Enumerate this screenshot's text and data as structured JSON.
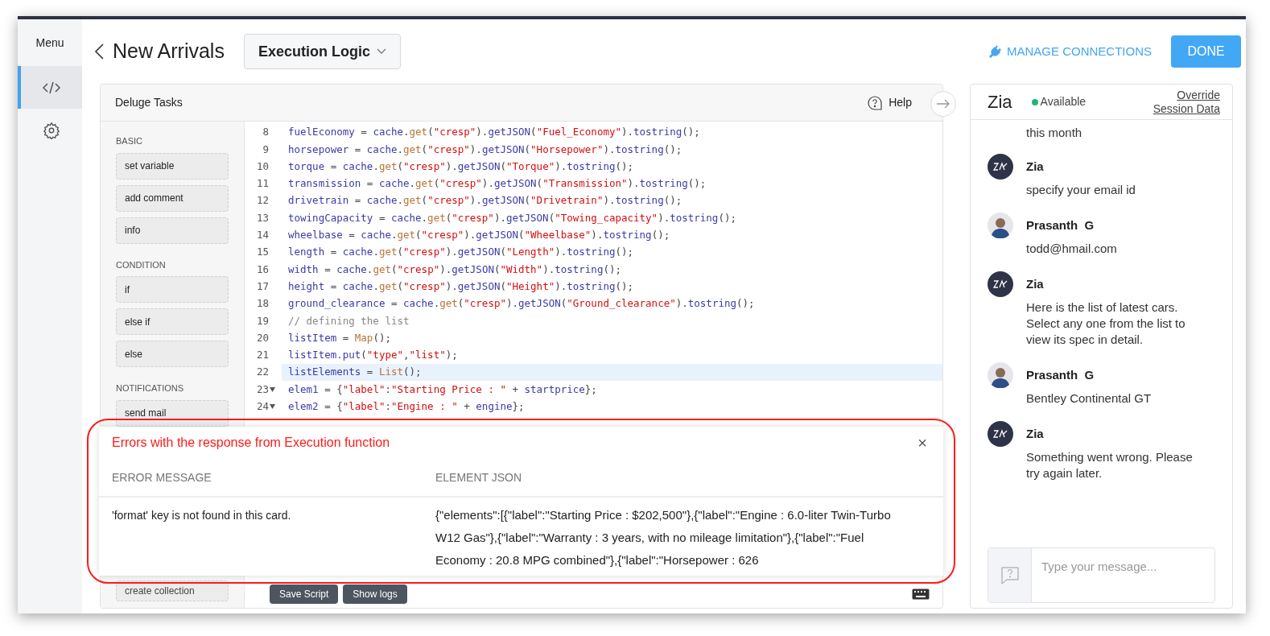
{
  "sidebar": {
    "title": "Menu",
    "items": [
      {
        "kind": "code",
        "selected": true
      },
      {
        "kind": "settings",
        "selected": false
      }
    ]
  },
  "header": {
    "title": "New Arrivals",
    "dropdown": "Execution Logic",
    "manage_connections": "MANAGE CONNECTIONS",
    "done": "DONE"
  },
  "editor": {
    "title": "Deluge Tasks",
    "help": "Help",
    "tasks": [
      {
        "title": "BASIC",
        "items": [
          "set variable",
          "add comment",
          "info"
        ]
      },
      {
        "title": "CONDITION",
        "items": [
          "if",
          "else if",
          "else"
        ]
      },
      {
        "title": "NOTIFICATIONS",
        "items": [
          "send mail"
        ]
      }
    ],
    "bottom_task": "create collection",
    "code_lines": [
      {
        "number": "8",
        "highlighted": false,
        "foldable": false,
        "tokens": [
          {
            "kind": "var",
            "text": "fuelEconomy"
          },
          {
            "kind": "op",
            "text": " = "
          },
          {
            "kind": "var",
            "text": "cache"
          },
          {
            "kind": "op",
            "text": "."
          },
          {
            "kind": "fn",
            "text": "get"
          },
          {
            "kind": "op",
            "text": "("
          },
          {
            "kind": "str",
            "text": "\"cresp\""
          },
          {
            "kind": "op",
            "text": ")."
          },
          {
            "kind": "var",
            "text": "getJSON"
          },
          {
            "kind": "op",
            "text": "("
          },
          {
            "kind": "str",
            "text": "\"Fuel_Economy\""
          },
          {
            "kind": "op",
            "text": ")."
          },
          {
            "kind": "var",
            "text": "tostring"
          },
          {
            "kind": "op",
            "text": "();"
          }
        ]
      },
      {
        "number": "9",
        "highlighted": false,
        "foldable": false,
        "tokens": [
          {
            "kind": "var",
            "text": "horsepower"
          },
          {
            "kind": "op",
            "text": " = "
          },
          {
            "kind": "var",
            "text": "cache"
          },
          {
            "kind": "op",
            "text": "."
          },
          {
            "kind": "fn",
            "text": "get"
          },
          {
            "kind": "op",
            "text": "("
          },
          {
            "kind": "str",
            "text": "\"cresp\""
          },
          {
            "kind": "op",
            "text": ")."
          },
          {
            "kind": "var",
            "text": "getJSON"
          },
          {
            "kind": "op",
            "text": "("
          },
          {
            "kind": "str",
            "text": "\"Horsepower\""
          },
          {
            "kind": "op",
            "text": ")."
          },
          {
            "kind": "var",
            "text": "tostring"
          },
          {
            "kind": "op",
            "text": "();"
          }
        ]
      },
      {
        "number": "10",
        "highlighted": false,
        "foldable": false,
        "tokens": [
          {
            "kind": "var",
            "text": "torque"
          },
          {
            "kind": "op",
            "text": " = "
          },
          {
            "kind": "var",
            "text": "cache"
          },
          {
            "kind": "op",
            "text": "."
          },
          {
            "kind": "fn",
            "text": "get"
          },
          {
            "kind": "op",
            "text": "("
          },
          {
            "kind": "str",
            "text": "\"cresp\""
          },
          {
            "kind": "op",
            "text": ")."
          },
          {
            "kind": "var",
            "text": "getJSON"
          },
          {
            "kind": "op",
            "text": "("
          },
          {
            "kind": "str",
            "text": "\"Torque\""
          },
          {
            "kind": "op",
            "text": ")."
          },
          {
            "kind": "var",
            "text": "tostring"
          },
          {
            "kind": "op",
            "text": "();"
          }
        ]
      },
      {
        "number": "11",
        "highlighted": false,
        "foldable": false,
        "tokens": [
          {
            "kind": "var",
            "text": "transmission"
          },
          {
            "kind": "op",
            "text": " = "
          },
          {
            "kind": "var",
            "text": "cache"
          },
          {
            "kind": "op",
            "text": "."
          },
          {
            "kind": "fn",
            "text": "get"
          },
          {
            "kind": "op",
            "text": "("
          },
          {
            "kind": "str",
            "text": "\"cresp\""
          },
          {
            "kind": "op",
            "text": ")."
          },
          {
            "kind": "var",
            "text": "getJSON"
          },
          {
            "kind": "op",
            "text": "("
          },
          {
            "kind": "str",
            "text": "\"Transmission\""
          },
          {
            "kind": "op",
            "text": ")."
          },
          {
            "kind": "var",
            "text": "tostring"
          },
          {
            "kind": "op",
            "text": "();"
          }
        ]
      },
      {
        "number": "12",
        "highlighted": false,
        "foldable": false,
        "tokens": [
          {
            "kind": "var",
            "text": "drivetrain"
          },
          {
            "kind": "op",
            "text": " = "
          },
          {
            "kind": "var",
            "text": "cache"
          },
          {
            "kind": "op",
            "text": "."
          },
          {
            "kind": "fn",
            "text": "get"
          },
          {
            "kind": "op",
            "text": "("
          },
          {
            "kind": "str",
            "text": "\"cresp\""
          },
          {
            "kind": "op",
            "text": ")."
          },
          {
            "kind": "var",
            "text": "getJSON"
          },
          {
            "kind": "op",
            "text": "("
          },
          {
            "kind": "str",
            "text": "\"Drivetrain\""
          },
          {
            "kind": "op",
            "text": ")."
          },
          {
            "kind": "var",
            "text": "tostring"
          },
          {
            "kind": "op",
            "text": "();"
          }
        ]
      },
      {
        "number": "13",
        "highlighted": false,
        "foldable": false,
        "tokens": [
          {
            "kind": "var",
            "text": "towingCapacity"
          },
          {
            "kind": "op",
            "text": " = "
          },
          {
            "kind": "var",
            "text": "cache"
          },
          {
            "kind": "op",
            "text": "."
          },
          {
            "kind": "fn",
            "text": "get"
          },
          {
            "kind": "op",
            "text": "("
          },
          {
            "kind": "str",
            "text": "\"cresp\""
          },
          {
            "kind": "op",
            "text": ")."
          },
          {
            "kind": "var",
            "text": "getJSON"
          },
          {
            "kind": "op",
            "text": "("
          },
          {
            "kind": "str",
            "text": "\"Towing_capacity\""
          },
          {
            "kind": "op",
            "text": ")."
          },
          {
            "kind": "var",
            "text": "tostring"
          },
          {
            "kind": "op",
            "text": "();"
          }
        ]
      },
      {
        "number": "14",
        "highlighted": false,
        "foldable": false,
        "tokens": [
          {
            "kind": "var",
            "text": "wheelbase"
          },
          {
            "kind": "op",
            "text": " = "
          },
          {
            "kind": "var",
            "text": "cache"
          },
          {
            "kind": "op",
            "text": "."
          },
          {
            "kind": "fn",
            "text": "get"
          },
          {
            "kind": "op",
            "text": "("
          },
          {
            "kind": "str",
            "text": "\"cresp\""
          },
          {
            "kind": "op",
            "text": ")."
          },
          {
            "kind": "var",
            "text": "getJSON"
          },
          {
            "kind": "op",
            "text": "("
          },
          {
            "kind": "str",
            "text": "\"Wheelbase\""
          },
          {
            "kind": "op",
            "text": ")."
          },
          {
            "kind": "var",
            "text": "tostring"
          },
          {
            "kind": "op",
            "text": "();"
          }
        ]
      },
      {
        "number": "15",
        "highlighted": false,
        "foldable": false,
        "tokens": [
          {
            "kind": "var",
            "text": "length"
          },
          {
            "kind": "op",
            "text": " = "
          },
          {
            "kind": "var",
            "text": "cache"
          },
          {
            "kind": "op",
            "text": "."
          },
          {
            "kind": "fn",
            "text": "get"
          },
          {
            "kind": "op",
            "text": "("
          },
          {
            "kind": "str",
            "text": "\"cresp\""
          },
          {
            "kind": "op",
            "text": ")."
          },
          {
            "kind": "var",
            "text": "getJSON"
          },
          {
            "kind": "op",
            "text": "("
          },
          {
            "kind": "str",
            "text": "\"Length\""
          },
          {
            "kind": "op",
            "text": ")."
          },
          {
            "kind": "var",
            "text": "tostring"
          },
          {
            "kind": "op",
            "text": "();"
          }
        ]
      },
      {
        "number": "16",
        "highlighted": false,
        "foldable": false,
        "tokens": [
          {
            "kind": "var",
            "text": "width"
          },
          {
            "kind": "op",
            "text": " = "
          },
          {
            "kind": "var",
            "text": "cache"
          },
          {
            "kind": "op",
            "text": "."
          },
          {
            "kind": "fn",
            "text": "get"
          },
          {
            "kind": "op",
            "text": "("
          },
          {
            "kind": "str",
            "text": "\"cresp\""
          },
          {
            "kind": "op",
            "text": ")."
          },
          {
            "kind": "var",
            "text": "getJSON"
          },
          {
            "kind": "op",
            "text": "("
          },
          {
            "kind": "str",
            "text": "\"Width\""
          },
          {
            "kind": "op",
            "text": ")."
          },
          {
            "kind": "var",
            "text": "tostring"
          },
          {
            "kind": "op",
            "text": "();"
          }
        ]
      },
      {
        "number": "17",
        "highlighted": false,
        "foldable": false,
        "tokens": [
          {
            "kind": "var",
            "text": "height"
          },
          {
            "kind": "op",
            "text": " = "
          },
          {
            "kind": "var",
            "text": "cache"
          },
          {
            "kind": "op",
            "text": "."
          },
          {
            "kind": "fn",
            "text": "get"
          },
          {
            "kind": "op",
            "text": "("
          },
          {
            "kind": "str",
            "text": "\"cresp\""
          },
          {
            "kind": "op",
            "text": ")."
          },
          {
            "kind": "var",
            "text": "getJSON"
          },
          {
            "kind": "op",
            "text": "("
          },
          {
            "kind": "str",
            "text": "\"Height\""
          },
          {
            "kind": "op",
            "text": ")."
          },
          {
            "kind": "var",
            "text": "tostring"
          },
          {
            "kind": "op",
            "text": "();"
          }
        ]
      },
      {
        "number": "18",
        "highlighted": false,
        "foldable": false,
        "tokens": [
          {
            "kind": "var",
            "text": "ground_clearance"
          },
          {
            "kind": "op",
            "text": " = "
          },
          {
            "kind": "var",
            "text": "cache"
          },
          {
            "kind": "op",
            "text": "."
          },
          {
            "kind": "fn",
            "text": "get"
          },
          {
            "kind": "op",
            "text": "("
          },
          {
            "kind": "str",
            "text": "\"cresp\""
          },
          {
            "kind": "op",
            "text": ")."
          },
          {
            "kind": "var",
            "text": "getJSON"
          },
          {
            "kind": "op",
            "text": "("
          },
          {
            "kind": "str",
            "text": "\"Ground_clearance\""
          },
          {
            "kind": "op",
            "text": ")."
          },
          {
            "kind": "var",
            "text": "tostring"
          },
          {
            "kind": "op",
            "text": "();"
          }
        ]
      },
      {
        "number": "19",
        "highlighted": false,
        "foldable": false,
        "tokens": [
          {
            "kind": "comment",
            "text": "// defining the list"
          }
        ]
      },
      {
        "number": "20",
        "highlighted": false,
        "foldable": false,
        "tokens": [
          {
            "kind": "var",
            "text": "listItem"
          },
          {
            "kind": "op",
            "text": " = "
          },
          {
            "kind": "fn",
            "text": "Map"
          },
          {
            "kind": "op",
            "text": "();"
          }
        ]
      },
      {
        "number": "21",
        "highlighted": false,
        "foldable": false,
        "tokens": [
          {
            "kind": "var",
            "text": "listItem.put"
          },
          {
            "kind": "op",
            "text": "("
          },
          {
            "kind": "str",
            "text": "\"type\""
          },
          {
            "kind": "op",
            "text": ","
          },
          {
            "kind": "str",
            "text": "\"list\""
          },
          {
            "kind": "op",
            "text": ");"
          }
        ]
      },
      {
        "number": "22",
        "highlighted": true,
        "foldable": false,
        "tokens": [
          {
            "kind": "var",
            "text": "listElements"
          },
          {
            "kind": "op",
            "text": " = "
          },
          {
            "kind": "fn",
            "text": "List"
          },
          {
            "kind": "op",
            "text": "();"
          }
        ]
      },
      {
        "number": "23",
        "highlighted": false,
        "foldable": true,
        "tokens": [
          {
            "kind": "var",
            "text": "elem1"
          },
          {
            "kind": "op",
            "text": " = {"
          },
          {
            "kind": "str",
            "text": "\"label\""
          },
          {
            "kind": "op",
            "text": ":"
          },
          {
            "kind": "str",
            "text": "\"Starting Price : \""
          },
          {
            "kind": "op",
            "text": " + "
          },
          {
            "kind": "var",
            "text": "startprice"
          },
          {
            "kind": "op",
            "text": "};"
          }
        ]
      },
      {
        "number": "24",
        "highlighted": false,
        "foldable": true,
        "tokens": [
          {
            "kind": "var",
            "text": "elem2"
          },
          {
            "kind": "op",
            "text": " = {"
          },
          {
            "kind": "str",
            "text": "\"label\""
          },
          {
            "kind": "op",
            "text": ":"
          },
          {
            "kind": "str",
            "text": "\"Engine : \""
          },
          {
            "kind": "op",
            "text": " + "
          },
          {
            "kind": "var",
            "text": "engine"
          },
          {
            "kind": "op",
            "text": "};"
          }
        ]
      }
    ],
    "buttons": [
      "Save Script",
      "Show logs"
    ]
  },
  "error_dialog": {
    "title": "Errors with the response from Execution function",
    "close": "×",
    "columns": [
      "ERROR MESSAGE",
      "ELEMENT JSON"
    ],
    "rows": [
      {
        "message": "'format' key is not found in this card.",
        "element_json": "{\"elements\":[{\"label\":\"Starting Price : $202,500\"},{\"label\":\"Engine : 6.0-liter Twin-Turbo W12 Gas\"},{\"label\":\"Warranty : 3 years, with no mileage limitation\"},{\"label\":\"Fuel Economy : 20.8 MPG combined\"},{\"label\":\"Horsepower : 626"
      }
    ]
  },
  "chat": {
    "title": "Zia",
    "status": "Available",
    "override": [
      "Override",
      "Session Data"
    ],
    "messages": [
      {
        "kind": "user_continued",
        "text": "this month"
      },
      {
        "kind": "bot",
        "sender": "Zia",
        "text": "specify your email id"
      },
      {
        "kind": "user",
        "sender": "Prasanth  G",
        "text": "todd@hmail.com"
      },
      {
        "kind": "bot",
        "sender": "Zia",
        "text": "Here is the list of latest cars. Select any one from the list to view its spec in detail."
      },
      {
        "kind": "user",
        "sender": "Prasanth  G",
        "text": "Bentley Continental GT"
      },
      {
        "kind": "bot",
        "sender": "Zia",
        "text": "Something went wrong. Please try again later."
      }
    ],
    "input_placeholder": "Type your message..."
  }
}
